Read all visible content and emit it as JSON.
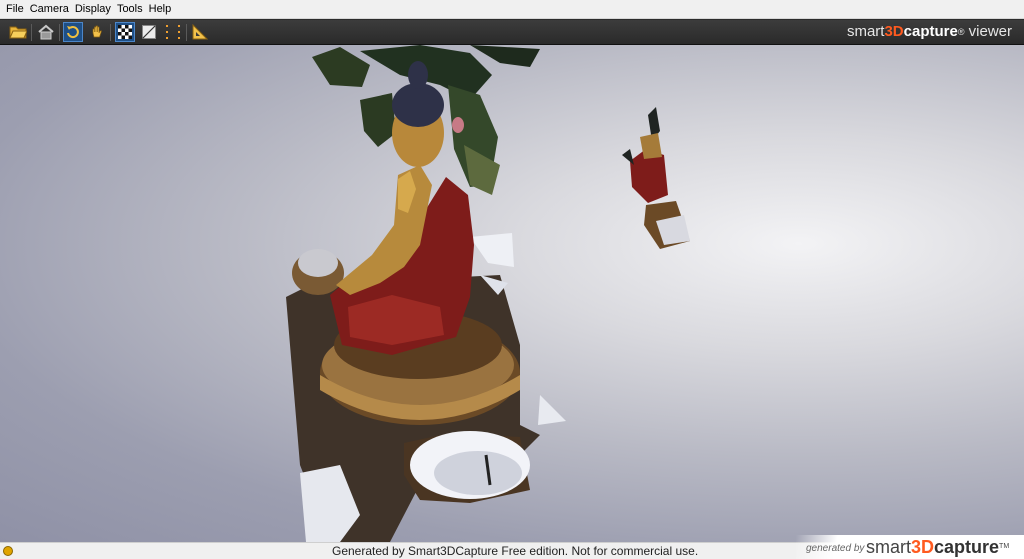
{
  "menu": {
    "items": [
      {
        "label": "File"
      },
      {
        "label": "Camera"
      },
      {
        "label": "Display"
      },
      {
        "label": "Tools"
      },
      {
        "label": "Help"
      }
    ]
  },
  "toolbar": {
    "buttons": [
      {
        "icon": "folder-open-icon"
      },
      {
        "icon": "home-icon"
      },
      {
        "icon": "rotate-icon",
        "active": true
      },
      {
        "icon": "pan-hand-icon"
      },
      {
        "icon": "checkerboard-icon",
        "active": true
      },
      {
        "icon": "wireframe-icon"
      },
      {
        "icon": "points-icon"
      },
      {
        "icon": "measure-icon"
      }
    ]
  },
  "brand": {
    "prefix": "smart",
    "accent": "3D",
    "suffix": "capture",
    "reg": "®",
    "viewer": " viewer"
  },
  "status": {
    "watermark": "Generated by Smart3DCapture Free edition. Not for commercial use."
  },
  "logo": {
    "generated_by": "generated by",
    "prefix": "smart",
    "accent": "3D",
    "suffix": "capture",
    "tm": "TM"
  },
  "colors": {
    "accent_orange": "#ff5a1f",
    "toolbar_bg": "#2e2e2e",
    "active_button": "#1e4f86",
    "menubar_bg": "#f0f0f0"
  }
}
